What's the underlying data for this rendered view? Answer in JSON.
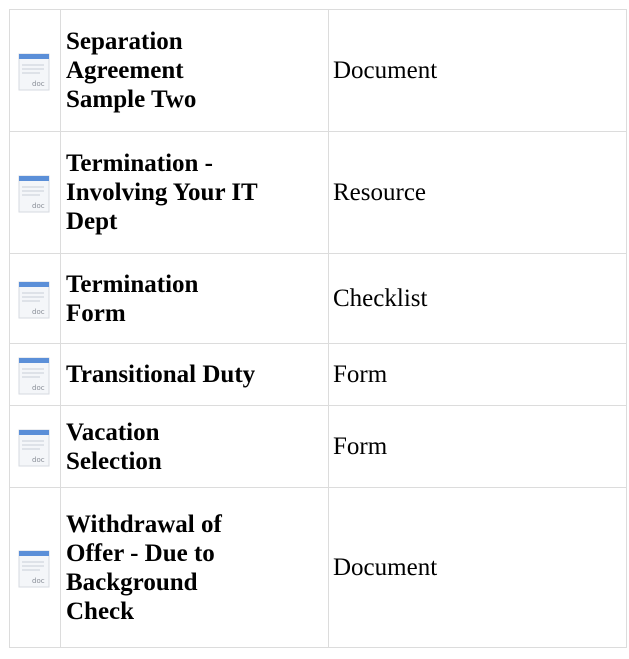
{
  "documents": [
    {
      "icon": "doc-file-icon",
      "icon_label": "doc",
      "name": "Separation Agreement Sample Two",
      "name_lines": [
        "Separation",
        "Agreement",
        "Sample Two"
      ],
      "type": "Document"
    },
    {
      "icon": "doc-file-icon",
      "icon_label": "doc",
      "name": "Termination - Involving Your IT Dept",
      "name_lines": [
        "Termination -",
        "Involving Your IT",
        "Dept"
      ],
      "type": "Resource"
    },
    {
      "icon": "doc-file-icon",
      "icon_label": "doc",
      "name": "Termination Form",
      "name_lines": [
        "Termination",
        "Form"
      ],
      "type": "Checklist"
    },
    {
      "icon": "doc-file-icon",
      "icon_label": "doc",
      "name": "Transitional Duty",
      "name_lines": [
        "Transitional Duty"
      ],
      "type": "Form"
    },
    {
      "icon": "doc-file-icon",
      "icon_label": "doc",
      "name": "Vacation Selection",
      "name_lines": [
        "Vacation",
        "Selection"
      ],
      "type": "Form"
    },
    {
      "icon": "doc-file-icon",
      "icon_label": "doc",
      "name": "Withdrawal of Offer - Due to Background Check",
      "name_lines": [
        "Withdrawal of",
        "Offer - Due to",
        "Background",
        "Check"
      ],
      "type": "Document"
    }
  ],
  "colors": {
    "icon_band": "#5b8fd8",
    "icon_page": "#f4f6f9",
    "icon_lines": "#c9ced6",
    "border": "#dcdcdc"
  }
}
